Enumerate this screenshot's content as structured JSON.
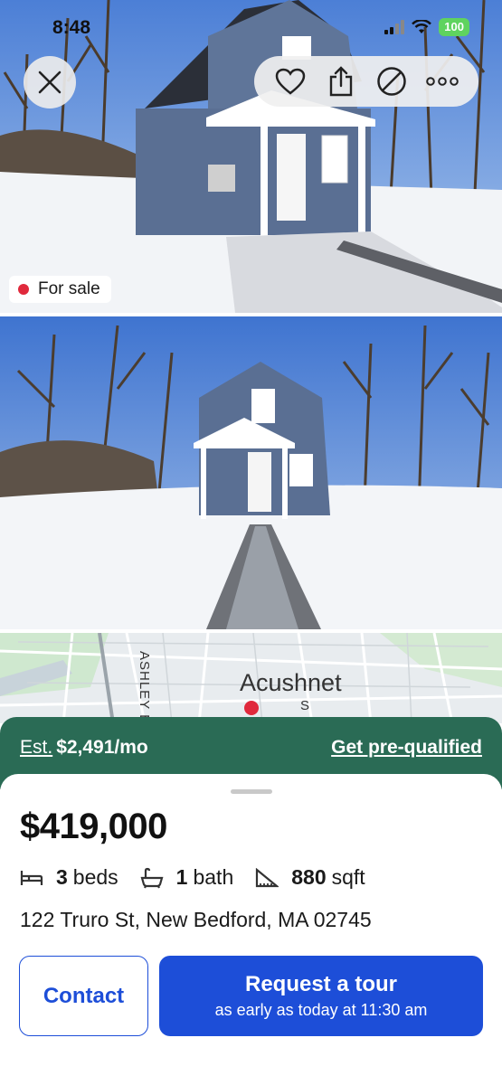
{
  "status_bar": {
    "time": "8:48",
    "battery": "100"
  },
  "toolbar": {
    "icons": [
      "close-icon",
      "heart-icon",
      "share-icon",
      "hide-icon",
      "more-icon"
    ]
  },
  "listing": {
    "status_label": "For sale",
    "status_color": "#e0293c",
    "price": "$419,000",
    "beds_count": "3",
    "beds_label": "beds",
    "baths_count": "1",
    "baths_label": "bath",
    "sqft_count": "880",
    "sqft_label": "sqft",
    "address": "122 Truro St, New Bedford, MA 02745"
  },
  "map": {
    "town_label": "Acushnet",
    "street_label": "ASHLEY B",
    "street_label_2": "S"
  },
  "finance": {
    "est_label": "Est.",
    "monthly": "$2,491/mo",
    "cta": "Get pre-qualified"
  },
  "actions": {
    "contact": "Contact",
    "tour_title": "Request a tour",
    "tour_subtitle": "as early as today at 11:30 am"
  },
  "colors": {
    "primary_blue": "#1d4ed8",
    "finance_green": "#2a6b55"
  }
}
